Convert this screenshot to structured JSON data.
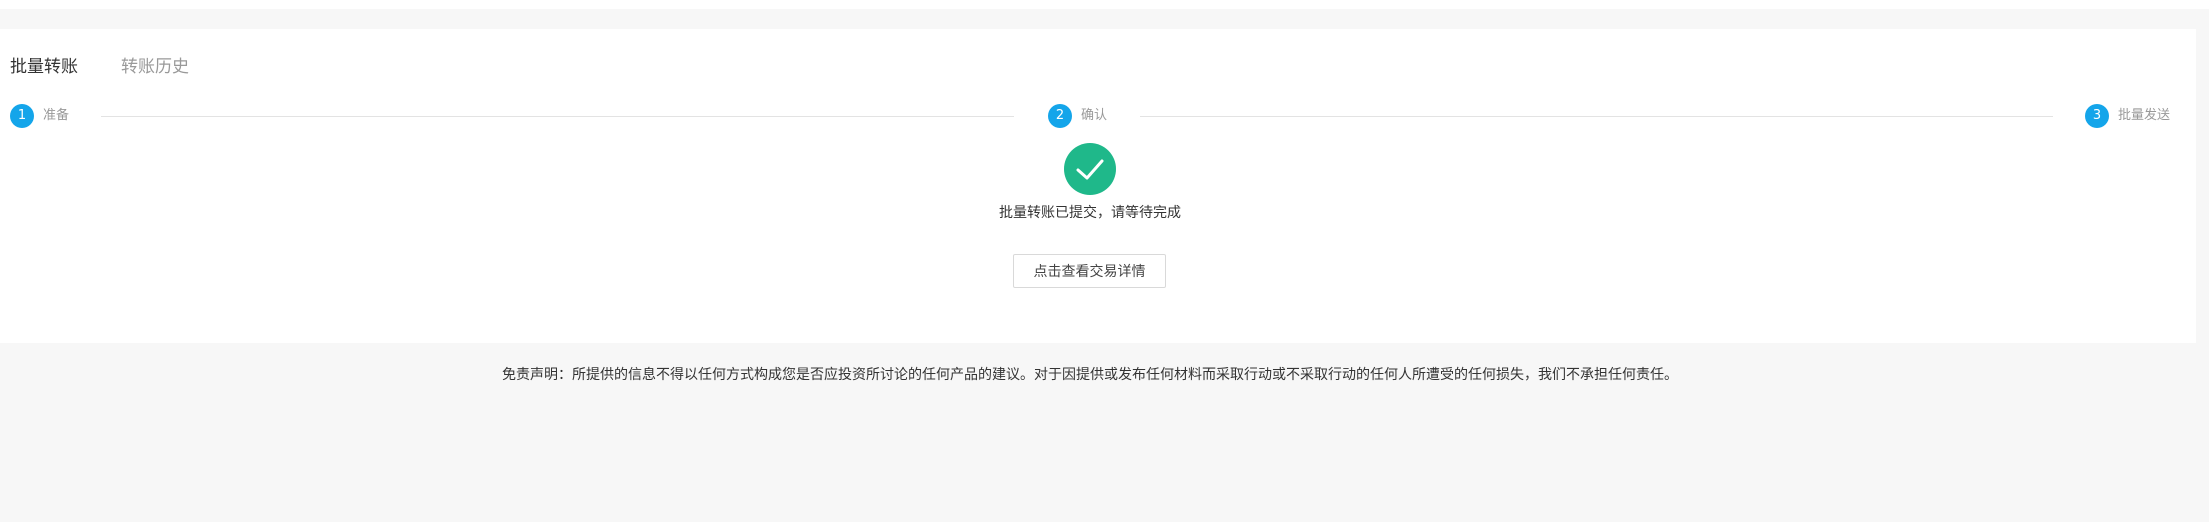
{
  "tabs": [
    {
      "label": "批量转账",
      "active": true
    },
    {
      "label": "转账历史",
      "active": false
    }
  ],
  "steps": [
    {
      "number": "1",
      "label": "准备"
    },
    {
      "number": "2",
      "label": "确认"
    },
    {
      "number": "3",
      "label": "批量发送"
    }
  ],
  "result": {
    "icon": "check-circle-icon",
    "message": "批量转账已提交，请等待完成",
    "detail_button": "点击查看交易详情"
  },
  "footer": {
    "disclaimer": "免责声明：所提供的信息不得以任何方式构成您是否应投资所讨论的任何产品的建议。对于因提供或发布任何材料而采取行动或不采取行动的任何人所遭受的任何损失，我们不承担任何责任。"
  },
  "colors": {
    "step_active": "#14a5ea",
    "success": "#1fb88a"
  }
}
